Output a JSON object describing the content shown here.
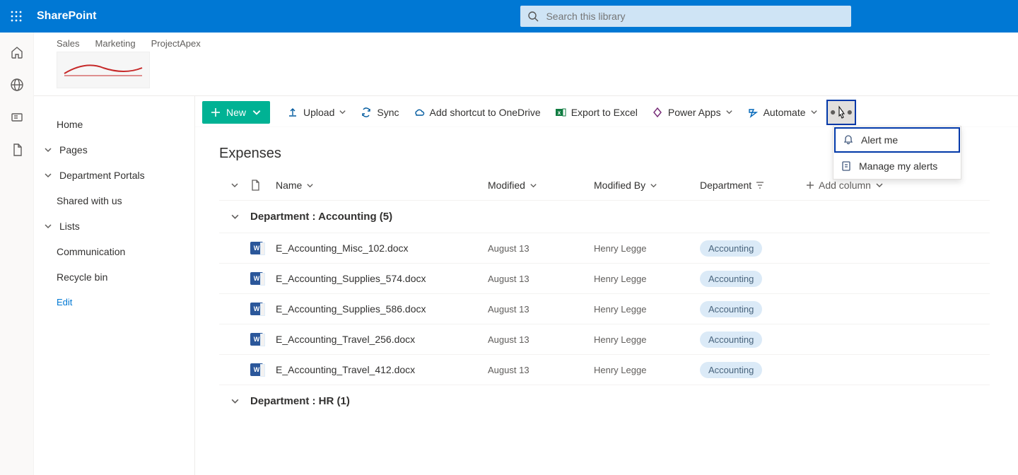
{
  "brand": "SharePoint",
  "search": {
    "placeholder": "Search this library"
  },
  "topnav": {
    "items": [
      "Sales",
      "Marketing",
      "ProjectApex"
    ]
  },
  "leftnav": {
    "home": "Home",
    "pages": "Pages",
    "portals": "Department Portals",
    "shared": "Shared with us",
    "lists": "Lists",
    "communication": "Communication",
    "recycle": "Recycle bin",
    "edit": "Edit"
  },
  "cmdbar": {
    "new": "New",
    "upload": "Upload",
    "sync": "Sync",
    "shortcut": "Add shortcut to OneDrive",
    "export": "Export to Excel",
    "powerapps": "Power Apps",
    "automate": "Automate"
  },
  "dropdown": {
    "alert": "Alert me",
    "manage": "Manage my alerts"
  },
  "library": {
    "title": "Expenses"
  },
  "columns": {
    "name": "Name",
    "modified": "Modified",
    "modifiedBy": "Modified By",
    "department": "Department",
    "add": "Add column"
  },
  "groups": [
    {
      "label": "Department : Accounting (5)"
    },
    {
      "label": "Department : HR (1)"
    }
  ],
  "rows": [
    {
      "name": "E_Accounting_Misc_102.docx",
      "modified": "August 13",
      "modifiedBy": "Henry Legge",
      "dept": "Accounting"
    },
    {
      "name": "E_Accounting_Supplies_574.docx",
      "modified": "August 13",
      "modifiedBy": "Henry Legge",
      "dept": "Accounting"
    },
    {
      "name": "E_Accounting_Supplies_586.docx",
      "modified": "August 13",
      "modifiedBy": "Henry Legge",
      "dept": "Accounting"
    },
    {
      "name": "E_Accounting_Travel_256.docx",
      "modified": "August 13",
      "modifiedBy": "Henry Legge",
      "dept": "Accounting"
    },
    {
      "name": "E_Accounting_Travel_412.docx",
      "modified": "August 13",
      "modifiedBy": "Henry Legge",
      "dept": "Accounting"
    }
  ]
}
